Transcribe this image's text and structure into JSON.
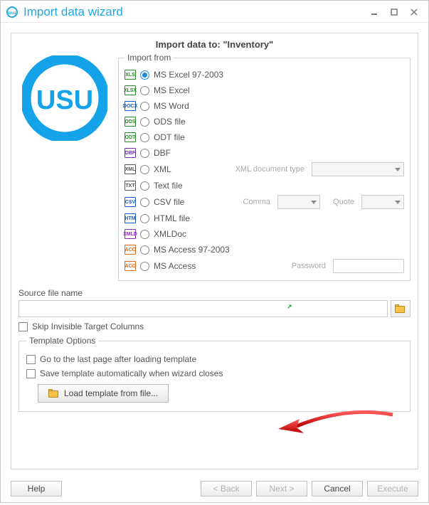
{
  "window": {
    "title": "Import data wizard"
  },
  "page_title": "Import data to: \"Inventory\"",
  "logo_text": "USU",
  "import_from": {
    "legend": "Import from",
    "selected_index": 0,
    "formats": [
      {
        "label": "MS Excel 97-2003",
        "badge": "XLS",
        "color": "#2a8a2a"
      },
      {
        "label": "MS Excel",
        "badge": "XLSX",
        "color": "#2a8a2a"
      },
      {
        "label": "MS Word",
        "badge": "DOCX",
        "color": "#1b5dbf"
      },
      {
        "label": "ODS file",
        "badge": "ODS",
        "color": "#2a8a2a"
      },
      {
        "label": "ODT file",
        "badge": "ODT",
        "color": "#2a8a2a"
      },
      {
        "label": "DBF",
        "badge": "DBF",
        "color": "#6a2fb5"
      },
      {
        "label": "XML",
        "badge": "XML",
        "color": "#555",
        "extra": {
          "label": "XML document type",
          "type": "combo-wide"
        }
      },
      {
        "label": "Text file",
        "badge": "TXT",
        "color": "#555"
      },
      {
        "label": "CSV file",
        "badge": "CSV",
        "color": "#1b5dbf",
        "extra": {
          "label": "Comma",
          "type": "combo-pair",
          "label2": "Quote"
        }
      },
      {
        "label": "HTML file",
        "badge": "HTM",
        "color": "#1b5dbf"
      },
      {
        "label": "XMLDoc",
        "badge": "XMLD",
        "color": "#8a2fb5"
      },
      {
        "label": "MS Access 97-2003",
        "badge": "ACC",
        "color": "#d96a1a"
      },
      {
        "label": "MS Access",
        "badge": "ACC",
        "color": "#d96a1a",
        "extra": {
          "label": "Password",
          "type": "text"
        }
      }
    ]
  },
  "source": {
    "label": "Source file name",
    "value": ""
  },
  "skip_invisible": "Skip Invisible Target Columns",
  "template": {
    "legend": "Template Options",
    "opt_goto": "Go to the last page after loading template",
    "opt_save": "Save template automatically when wizard closes",
    "load_button": "Load template from file..."
  },
  "buttons": {
    "help": "Help",
    "back": "< Back",
    "next": "Next >",
    "cancel": "Cancel",
    "execute": "Execute"
  }
}
